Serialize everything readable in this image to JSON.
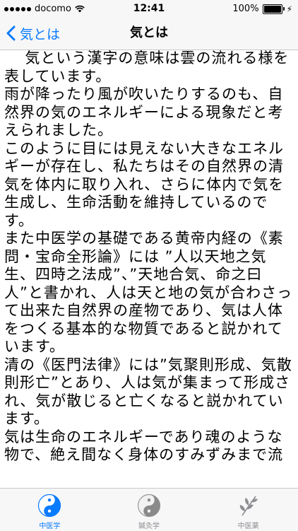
{
  "status_bar": {
    "carrier": "docomo",
    "time": "12:41",
    "battery": "100%",
    "battery_level": 1.0
  },
  "nav": {
    "back_label": "気とは",
    "title": "気とは"
  },
  "content": {
    "paragraphs": [
      "気という漢字の意味は雲の流れる様を表しています。",
      "雨が降ったり風が吹いたりするのも、自然界の気のエネルギーによる現象だと考えられました。",
      "このように目には見えない大きなエネルギーが存在し、私たちはその自然界の清気を体内に取り入れ、さらに体内で気を生成し、生命活動を維持しているのです。",
      "また中医学の基礎である黄帝内経の《素問・宝命全形論》には ”人以天地之気生、四時之法成”、”天地合気、命之曰人”と書かれ、人は天と地の気が合わさって出来た自然界の産物であり、気は人体をつくる基本的な物質であると説かれています。",
      "清の《医門法律》には”気聚則形成、気散則形亡”とあり、人は気が集まって形成され、気が散じると亡くなると説かれています。",
      "気は生命のエネルギーであり魂のような物で、絶え間なく身体のすみずみまで流"
    ]
  },
  "tabs": [
    {
      "label": "中医学",
      "icon": "yin-yang-icon",
      "active": true
    },
    {
      "label": "鍼灸学",
      "icon": "yin-yang-icon",
      "active": false
    },
    {
      "label": "中医薬",
      "icon": "herb-leaf-icon",
      "active": false
    }
  ],
  "colors": {
    "accent": "#0a7bff",
    "inactive": "#8e8e93",
    "bar_background": "#f7f7f7"
  }
}
